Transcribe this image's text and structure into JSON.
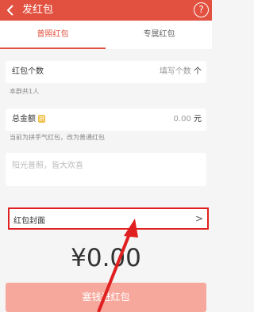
{
  "header": {
    "title": "发红包",
    "help_glyph": "?"
  },
  "tabs": [
    {
      "label": "普照红包",
      "active": true
    },
    {
      "label": "专属红包",
      "active": false
    }
  ],
  "count": {
    "label": "红包个数",
    "placeholder": "填写个数",
    "unit": "个",
    "hint": "本群共1人"
  },
  "total": {
    "label": "总金额",
    "badge": "拼",
    "value": "0.00",
    "unit": "元",
    "hint": "当前为拼手气红包，改为普通红包"
  },
  "message": {
    "placeholder": "阳光普照，皆大欢喜"
  },
  "cover": {
    "label": "红包封面",
    "chevron": ">"
  },
  "amount_display": "¥0.00",
  "submit_label": "塞钱进红包",
  "colors": {
    "brand": "#e25140",
    "highlight_box": "#e02020",
    "submit_disabled": "#f6a89c"
  }
}
